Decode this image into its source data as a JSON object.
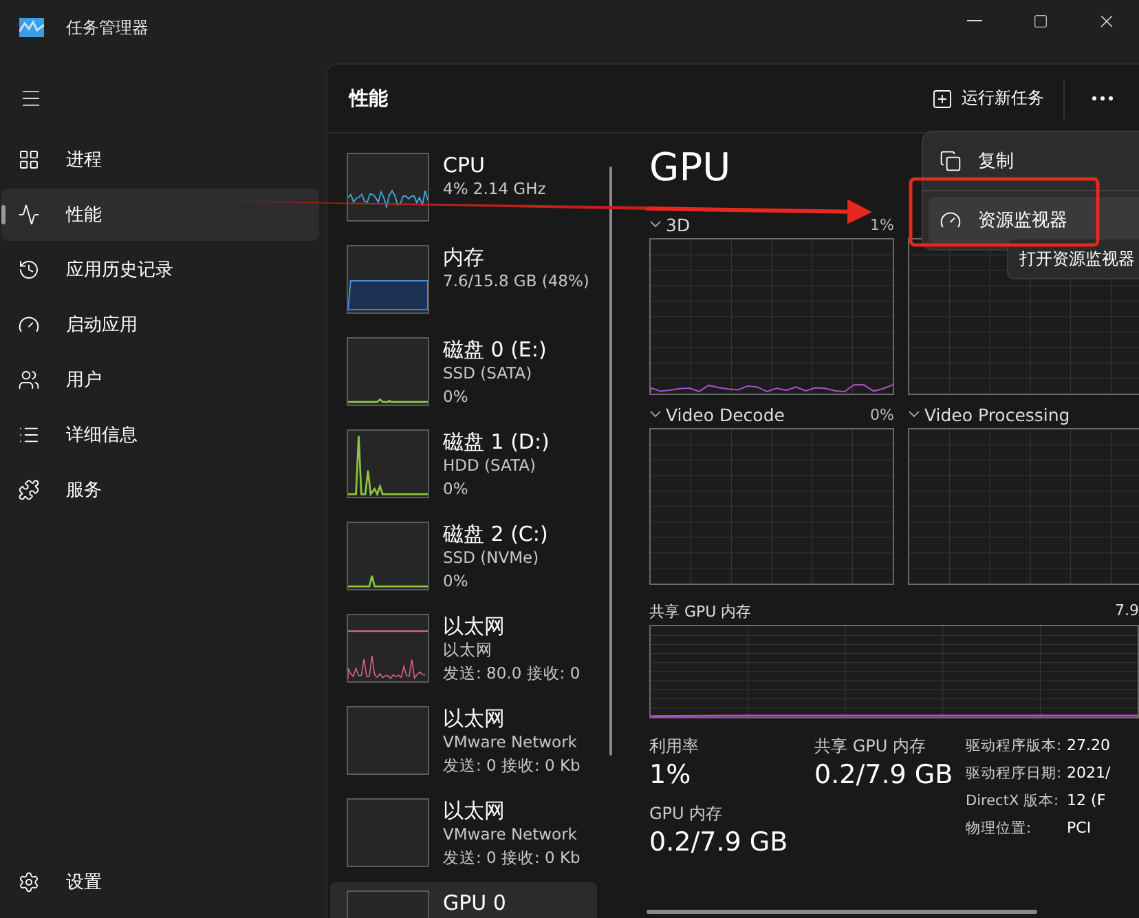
{
  "window": {
    "title": "任务管理器"
  },
  "sidebar": {
    "items": [
      {
        "label": "进程",
        "selected": false
      },
      {
        "label": "性能",
        "selected": true
      },
      {
        "label": "应用历史记录",
        "selected": false
      },
      {
        "label": "启动应用",
        "selected": false
      },
      {
        "label": "用户",
        "selected": false
      },
      {
        "label": "详细信息",
        "selected": false
      },
      {
        "label": "服务",
        "selected": false
      }
    ],
    "settings": {
      "label": "设置"
    }
  },
  "header": {
    "title": "性能",
    "run_task": "运行新任务"
  },
  "devices": [
    {
      "name": "CPU",
      "lines": [
        "4% 2.14 GHz"
      ],
      "kind": "cpu",
      "color": "#3aa7d9",
      "selected": false
    },
    {
      "name": "内存",
      "lines": [
        "7.6/15.8 GB (48%)"
      ],
      "kind": "memory",
      "color": "#4b8fe8",
      "selected": false
    },
    {
      "name": "磁盘 0 (E:)",
      "lines": [
        "SSD (SATA)",
        "0%"
      ],
      "kind": "disk",
      "color": "#8cc63f",
      "selected": false
    },
    {
      "name": "磁盘 1 (D:)",
      "lines": [
        "HDD (SATA)",
        "0%"
      ],
      "kind": "disk",
      "color": "#8cc63f",
      "selected": false
    },
    {
      "name": "磁盘 2 (C:)",
      "lines": [
        "SSD (NVMe)",
        "0%"
      ],
      "kind": "disk",
      "color": "#8cc63f",
      "selected": false
    },
    {
      "name": "以太网",
      "lines": [
        "以太网",
        "发送: 80.0 接收: 0"
      ],
      "kind": "network",
      "color": "#e0609a",
      "selected": false
    },
    {
      "name": "以太网",
      "lines": [
        "VMware Network",
        "发送: 0 接收: 0 Kb"
      ],
      "kind": "empty",
      "selected": false
    },
    {
      "name": "以太网",
      "lines": [
        "VMware Network",
        "发送: 0 接收: 0 Kb"
      ],
      "kind": "empty",
      "selected": false
    },
    {
      "name": "GPU 0",
      "kind": "empty",
      "selected": true
    }
  ],
  "detail": {
    "title": "GPU",
    "engines": [
      {
        "label": "3D",
        "value": "1%",
        "kind": "trace"
      },
      {
        "kind": "flat"
      },
      {
        "label": "Video Decode",
        "value": "0%",
        "kind": "flat"
      },
      {
        "label": "Video Processing",
        "kind": "flat"
      }
    ],
    "shared_memory": {
      "label": "共享 GPU 内存",
      "max": "7.9"
    },
    "stats": [
      {
        "label": "利用率",
        "value": "1%"
      },
      {
        "label": "共享 GPU 内存",
        "value": "0.2/7.9 GB"
      },
      {
        "label": "GPU 内存",
        "value": "0.2/7.9 GB"
      }
    ],
    "properties": [
      {
        "label": "驱动程序版本:",
        "value": "27.20"
      },
      {
        "label": "驱动程序日期:",
        "value": "2021/"
      },
      {
        "label": "DirectX 版本:",
        "value": "12 (F"
      },
      {
        "label": "物理位置:",
        "value": "PCI"
      }
    ]
  },
  "context_menu": {
    "items": [
      {
        "label": "复制",
        "highlighted": false
      },
      {
        "label": "资源监视器",
        "highlighted": true
      }
    ],
    "tooltip": "打开资源监视器"
  }
}
